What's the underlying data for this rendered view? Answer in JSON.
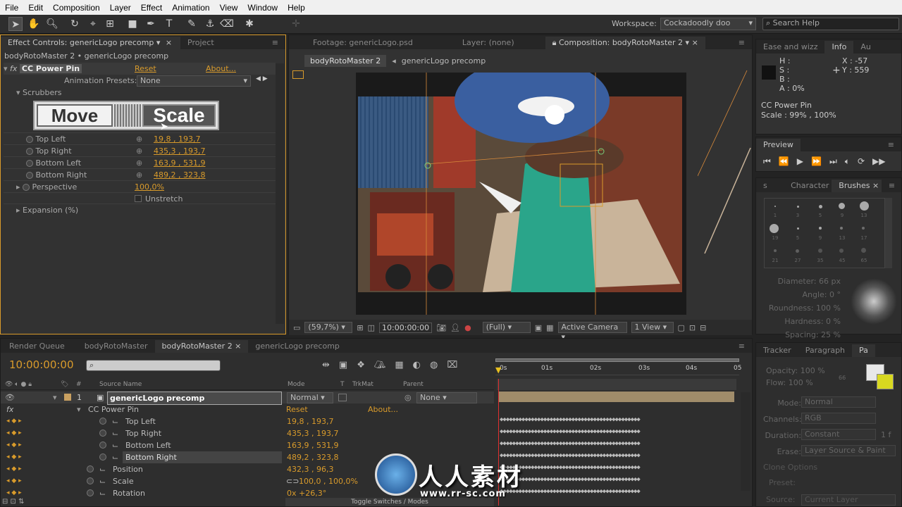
{
  "menu": [
    "File",
    "Edit",
    "Composition",
    "Layer",
    "Effect",
    "Animation",
    "View",
    "Window",
    "Help"
  ],
  "workspace": {
    "label": "Workspace:",
    "value": "Cockadoodly doo",
    "search_placeholder": "Search Help"
  },
  "effect_controls": {
    "tabs": [
      "Effect Controls: genericLogo precomp",
      "Project"
    ],
    "breadcrumb": "bodyRotoMaster 2 • genericLogo precomp",
    "effect_name": "CC Power Pin",
    "reset": "Reset",
    "about": "About...",
    "presets_label": "Animation Presets:",
    "presets_value": "None",
    "scrubbers": "Scrubbers",
    "move_btn": "Move",
    "scale_btn": "Scale",
    "props": [
      {
        "name": "Top Left",
        "value": "19,8 , 193,7"
      },
      {
        "name": "Top Right",
        "value": "435,3 , 193,7"
      },
      {
        "name": "Bottom Left",
        "value": "163,9 , 531,9"
      },
      {
        "name": "Bottom Right",
        "value": "489,2 , 323,8"
      }
    ],
    "perspective": {
      "name": "Perspective",
      "value": "100,0%"
    },
    "unstretch": "Unstretch",
    "expansion": "Expansion (%)"
  },
  "viewer": {
    "tabs": [
      "Footage: genericLogo.psd",
      "Layer: (none)",
      "Composition: bodyRotoMaster 2"
    ],
    "crumbs": [
      "bodyRotoMaster 2",
      "genericLogo precomp"
    ],
    "zoom": "(59,7%)",
    "timecode": "10:00:00:00",
    "resolution": "(Full)",
    "camera": "Active Camera",
    "views": "1 View"
  },
  "info": {
    "tabs": [
      "Ease and wizz",
      "Info",
      "Au"
    ],
    "h": "H :",
    "s": "S :",
    "b": "B :",
    "a": "A : 0%",
    "x": "X : -57",
    "y": "Y : 559",
    "line1": "CC Power Pin",
    "line2": "Scale : 99% , 100%"
  },
  "preview": {
    "title": "Preview"
  },
  "brushes": {
    "tabs": [
      "s",
      "Character",
      "Brushes"
    ],
    "sizes": [
      "1",
      "3",
      "5",
      "9",
      "13",
      "19",
      "5",
      "9",
      "13",
      "17",
      "21",
      "27",
      "35",
      "45",
      "65"
    ],
    "diameter": "Diameter: 66 px",
    "angle": "Angle: 0 °",
    "roundness": "Roundness: 100 %",
    "hardness": "Hardness: 0 %",
    "spacing": "Spacing: 25 %"
  },
  "paint": {
    "tabs": [
      "Tracker",
      "Paragraph",
      "Pa"
    ],
    "opacity": "Opacity: 100 %",
    "flow": "Flow: 100 %",
    "brush_size": "66",
    "mode_label": "Mode:",
    "mode": "Normal",
    "channels_label": "Channels:",
    "channels": "RGB",
    "duration_label": "Duration:",
    "duration": "Constant",
    "duration_frames": "1 f",
    "erase_label": "Erase:",
    "erase": "Layer Source & Paint",
    "clone": "Clone Options",
    "preset_label": "Preset:",
    "source_label": "Source:",
    "source": "Current Layer",
    "colors": {
      "fg": "#e8e8e8",
      "bg": "#d8d820"
    }
  },
  "timeline": {
    "tabs": [
      "Render Queue",
      "bodyRotoMaster",
      "bodyRotoMaster 2",
      "genericLogo precomp"
    ],
    "timecode": "10:00:00:00",
    "search_placeholder": "",
    "cols": {
      "source": "Source Name",
      "mode": "Mode",
      "t": "T",
      "trkmat": "TrkMat",
      "parent": "Parent"
    },
    "layer": {
      "num": "1",
      "name": "genericLogo precomp",
      "mode": "Normal",
      "parent": "None"
    },
    "effect": {
      "name": "CC Power Pin",
      "reset": "Reset",
      "about": "About..."
    },
    "props": [
      {
        "name": "Top Left",
        "value": "19,8 , 193,7"
      },
      {
        "name": "Top Right",
        "value": "435,3 , 193,7"
      },
      {
        "name": "Bottom Left",
        "value": "163,9 , 531,9"
      },
      {
        "name": "Bottom Right",
        "value": "489,2 , 323,8"
      }
    ],
    "transform": [
      {
        "name": "Position",
        "value": "432,3 , 96,3"
      },
      {
        "name": "Scale",
        "value": "100,0 , 100,0%"
      },
      {
        "name": "Rotation",
        "value": "0x +26,3°"
      }
    ],
    "ruler": [
      "0s",
      "01s",
      "02s",
      "03s",
      "04s",
      "05"
    ],
    "toggle": "Toggle Switches / Modes"
  },
  "watermark": {
    "text": "人人素材",
    "url": "www.rr-sc.com"
  }
}
